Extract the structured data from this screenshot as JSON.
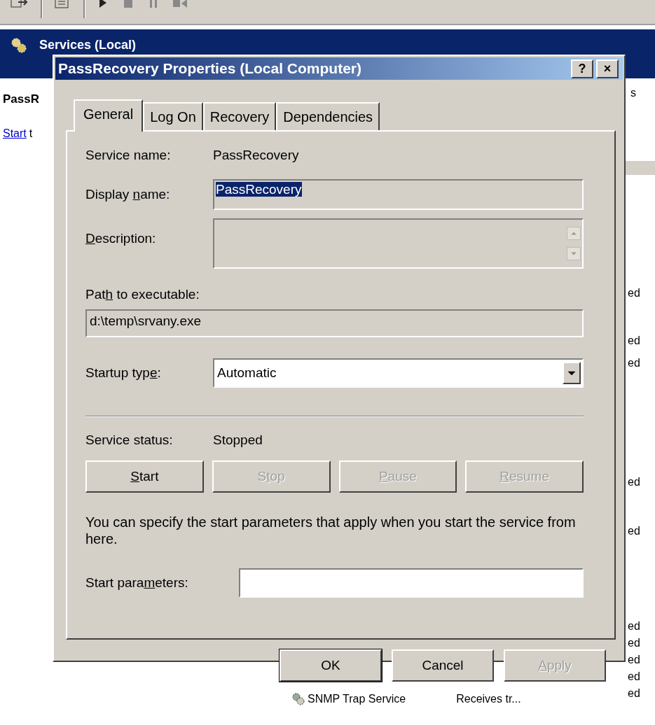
{
  "background_window": {
    "header": {
      "title": "Services (Local)"
    },
    "detail": {
      "heading": "PassR",
      "link": "Start",
      "link_tail": "t"
    },
    "list": {
      "column_header": "s",
      "status_cells": [
        "ed",
        "ed",
        "ed",
        "ed",
        "ed",
        "ed",
        "ed",
        "ed",
        "ed",
        "ed"
      ]
    },
    "bottom_row": {
      "name": "SNMP Trap Service",
      "description": "Receives tr..."
    }
  },
  "dialog": {
    "title": "PassRecovery Properties (Local Computer)",
    "title_buttons": [
      "?",
      "×"
    ],
    "tabs": [
      {
        "label": "General",
        "selected": true
      },
      {
        "label": "Log On",
        "selected": false
      },
      {
        "label": "Recovery",
        "selected": false
      },
      {
        "label": "Dependencies",
        "selected": false
      }
    ],
    "service_name": {
      "label": [
        {
          "text": "Service name:",
          "underlined": false
        }
      ],
      "value": "PassRecovery"
    },
    "display_name": {
      "label": [
        {
          "text": "Display ",
          "underlined": false
        },
        {
          "text": "n",
          "underlined": true
        },
        {
          "text": "ame:",
          "underlined": false
        }
      ],
      "value": "PassRecovery",
      "selected": true
    },
    "description": {
      "label": [
        {
          "text": "D",
          "underlined": true
        },
        {
          "text": "escription:",
          "underlined": false
        }
      ]
    },
    "path": {
      "label": [
        {
          "text": "Pat",
          "underlined": false
        },
        {
          "text": "h",
          "underlined": true
        },
        {
          "text": " to executable:",
          "underlined": false
        }
      ],
      "value": "d:\\temp\\srvany.exe"
    },
    "startup_type": {
      "label": [
        {
          "text": "Startup typ",
          "underlined": false
        },
        {
          "text": "e",
          "underlined": true
        },
        {
          "text": ":",
          "underlined": false
        }
      ],
      "value": "Automatic"
    },
    "service_status": {
      "label": [
        {
          "text": "Service status:",
          "underlined": false
        }
      ],
      "value": "Stopped"
    },
    "control_buttons": [
      {
        "label": [
          {
            "text": "S",
            "underlined": true
          },
          {
            "text": "tart",
            "underlined": false
          }
        ],
        "disabled": false
      },
      {
        "label": [
          {
            "text": "S",
            "underlined": false
          },
          {
            "text": "t",
            "underlined": true
          },
          {
            "text": "op",
            "underlined": false
          }
        ],
        "disabled": true
      },
      {
        "label": [
          {
            "text": "P",
            "underlined": true
          },
          {
            "text": "ause",
            "underlined": false
          }
        ],
        "disabled": true
      },
      {
        "label": [
          {
            "text": "R",
            "underlined": true
          },
          {
            "text": "esume",
            "underlined": false
          }
        ],
        "disabled": true
      }
    ],
    "hint": "You can specify the start parameters that apply when you start the service from here.",
    "start_parameters": {
      "label": [
        {
          "text": "Start para",
          "underlined": false
        },
        {
          "text": "m",
          "underlined": true
        },
        {
          "text": "eters:",
          "underlined": false
        }
      ]
    },
    "buttons": [
      {
        "label": [
          {
            "text": "OK",
            "underlined": false
          }
        ],
        "default": true,
        "disabled": false
      },
      {
        "label": [
          {
            "text": "Cancel",
            "underlined": false
          }
        ],
        "default": false,
        "disabled": false
      },
      {
        "label": [
          {
            "text": "A",
            "underlined": true
          },
          {
            "text": "pply",
            "underlined": false
          }
        ],
        "default": false,
        "disabled": true
      }
    ]
  }
}
